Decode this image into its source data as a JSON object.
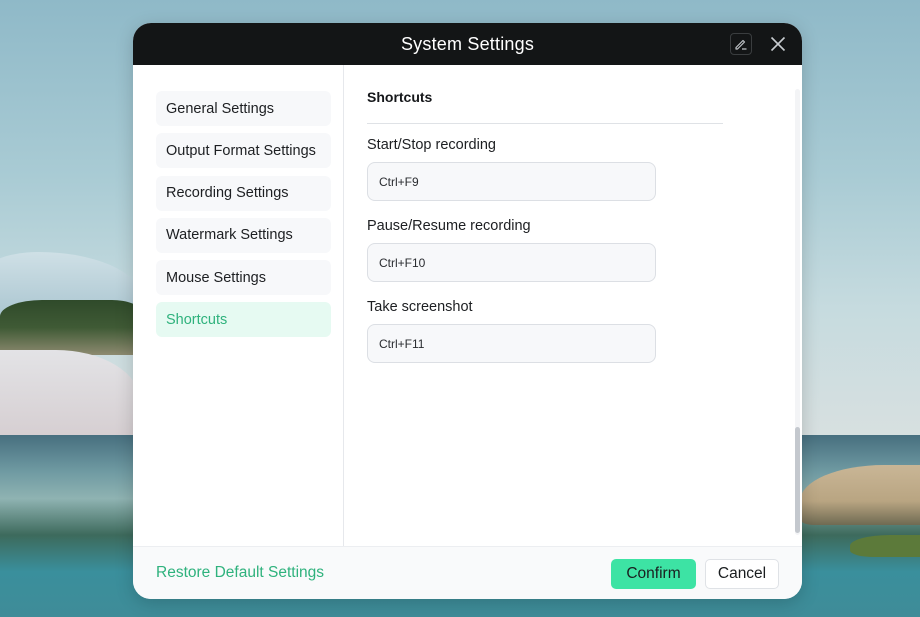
{
  "dialog": {
    "title": "System Settings",
    "icons": {
      "edit": "edit-pencil-icon",
      "close": "close-icon"
    }
  },
  "sidebar": {
    "items": [
      {
        "label": "General Settings",
        "active": false
      },
      {
        "label": "Output Format Settings",
        "active": false
      },
      {
        "label": "Recording Settings",
        "active": false
      },
      {
        "label": "Watermark Settings",
        "active": false
      },
      {
        "label": "Mouse Settings",
        "active": false
      },
      {
        "label": "Shortcuts",
        "active": true
      }
    ]
  },
  "content": {
    "section_title": "Shortcuts",
    "fields": [
      {
        "label": "Start/Stop recording",
        "value": "Ctrl+F9"
      },
      {
        "label": "Pause/Resume recording",
        "value": "Ctrl+F10"
      },
      {
        "label": "Take screenshot",
        "value": "Ctrl+F11"
      }
    ]
  },
  "footer": {
    "restore_label": "Restore Default Settings",
    "confirm_label": "Confirm",
    "cancel_label": "Cancel"
  },
  "colors": {
    "accent": "#2fb27d",
    "confirm_bg": "#3de3a4",
    "active_item_bg": "#e6faf2",
    "titlebar_bg": "#131516"
  }
}
